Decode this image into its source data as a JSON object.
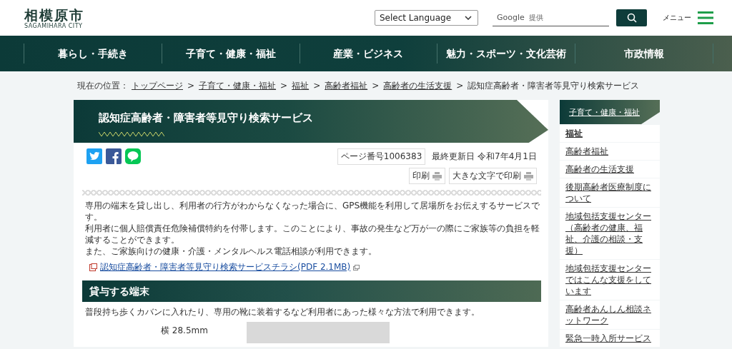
{
  "header": {
    "logo_title": "相模原市",
    "logo_subtitle": "SAGAMIHARA CITY",
    "language_select": "Select Language",
    "search": {
      "placeholder": "提供",
      "brand": "Google"
    },
    "menu_label": "メニュー"
  },
  "nav": [
    {
      "label": "暮らし・手続き"
    },
    {
      "label": "子育て・健康・福祉"
    },
    {
      "label": "産業・ビジネス"
    },
    {
      "label": "魅力・スポーツ・文化芸術"
    },
    {
      "label": "市政情報"
    }
  ],
  "breadcrumb": {
    "label": "現在の位置：",
    "separator": ">",
    "links": [
      "トップページ",
      "子育て・健康・福祉",
      "福祉",
      "高齢者福祉",
      "高齢者の生活支援"
    ],
    "current": "認知症高齢者・障害者等見守り検索サービス"
  },
  "page": {
    "title": "認知症高齢者・障害者等見守り検索サービス",
    "page_number": "ページ番号1006383",
    "updated": "最終更新日 令和7年4月1日",
    "print_buttons": [
      "印刷",
      "大きな文字で印刷"
    ],
    "paragraphs": [
      "専用の端末を貸し出し、利用者の行方がわからなくなった場合に、GPS機能を利用して居場所をお伝えするサービスです。",
      "利用者に個人賠償責任危険補償特約を付帯します。このことにより、事故の発生など万が一の際にご家族等の負担を軽減することができます。",
      "また、ご家族向けの健康・介護・メンタルヘルス電話相談が利用できます。"
    ],
    "pdf_link": "認知症高齢者・障害者等見守り検索サービスチラシ(PDF 2.1MB)",
    "section_heading": "貸与する端末",
    "section_text": "普段持ち歩くカバンに入れたり、専用の靴に装着するなど利用者にあった様々な方法で利用できます。",
    "dimension_label": "横 28.5mm"
  },
  "sidebar": {
    "heading": "子育て・健康・福祉",
    "items": [
      {
        "label": "福祉",
        "selected": true
      },
      {
        "label": "高齢者福祉",
        "selected": false
      },
      {
        "label": "高齢者の生活支援",
        "selected": false
      },
      {
        "label": "後期高齢者医療制度について",
        "selected": false
      },
      {
        "label": "地域包括支援センター（高齢者の健康、福祉、介護の相談・支援）",
        "selected": false
      },
      {
        "label": "地域包括支援センターではこんな支援をしています",
        "selected": false
      },
      {
        "label": "高齢者あんしん相談ネットワーク",
        "selected": false
      },
      {
        "label": "緊急一時入所サービス",
        "selected": false
      }
    ]
  }
}
